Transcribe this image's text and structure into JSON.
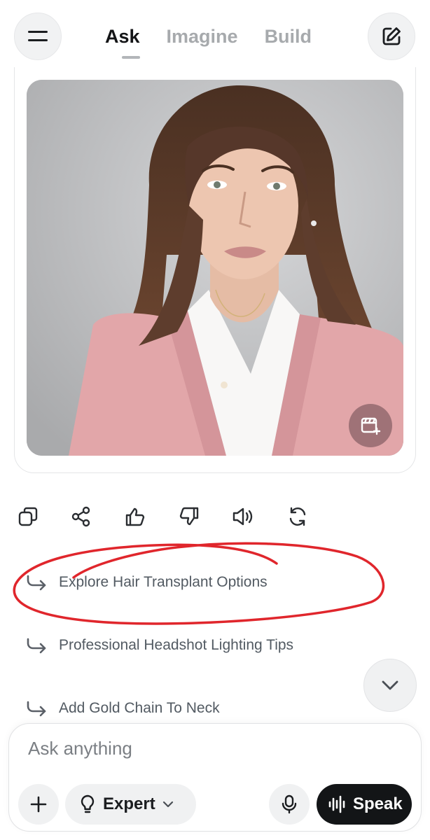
{
  "header": {
    "tabs": [
      {
        "label": "Ask",
        "active": true
      },
      {
        "label": "Imagine",
        "active": false
      },
      {
        "label": "Build",
        "active": false
      }
    ],
    "menu_icon": "menu-icon",
    "edit_icon": "edit-icon"
  },
  "image_card": {
    "image_subject": "portrait of a woman with shoulder-length brown hair wearing a pink blazer over a white shirt",
    "fab_icon": "image-edit-icon"
  },
  "actions": [
    "copy-icon",
    "share-icon",
    "thumbs-up-icon",
    "thumbs-down-icon",
    "speaker-icon",
    "regenerate-icon"
  ],
  "suggestions": [
    {
      "label": "Explore Hair Transplant Options",
      "circled": true
    },
    {
      "label": "Professional Headshot Lighting Tips",
      "circled": false
    },
    {
      "label": "Add Gold Chain To Neck",
      "circled": false
    }
  ],
  "composer": {
    "placeholder": "Ask anything",
    "mode_label": "Expert",
    "speak_label": "Speak"
  },
  "colors": {
    "annotation": "#e0262c",
    "speak_button": "#131517",
    "active_tab": "#141517",
    "inactive_tab": "#a7aaad",
    "blazer": "#e3a9ab"
  }
}
